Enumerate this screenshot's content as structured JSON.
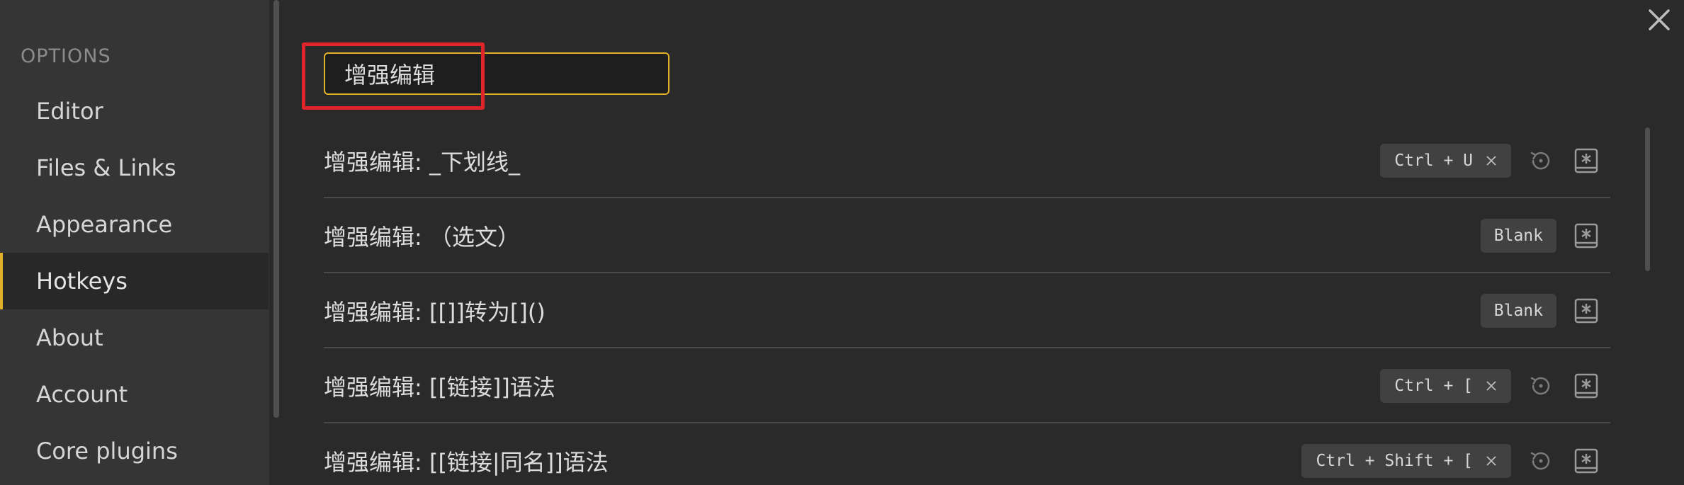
{
  "sidebar": {
    "heading": "OPTIONS",
    "items": [
      {
        "label": "Editor",
        "active": false
      },
      {
        "label": "Files & Links",
        "active": false
      },
      {
        "label": "Appearance",
        "active": false
      },
      {
        "label": "Hotkeys",
        "active": true
      },
      {
        "label": "About",
        "active": false
      },
      {
        "label": "Account",
        "active": false
      },
      {
        "label": "Core plugins",
        "active": false
      }
    ]
  },
  "search": {
    "value": "增强编辑",
    "placeholder": ""
  },
  "hotkeys": [
    {
      "name": "增强编辑: _下划线_",
      "hotkey": "Ctrl + U",
      "removable": true,
      "restore": true
    },
    {
      "name": "增强编辑: （选文）",
      "hotkey": "Blank",
      "removable": false,
      "restore": false
    },
    {
      "name": "增强编辑: [[]]转为[]()",
      "hotkey": "Blank",
      "removable": false,
      "restore": false
    },
    {
      "name": "增强编辑: [[链接]]语法",
      "hotkey": "Ctrl + [",
      "removable": true,
      "restore": true
    },
    {
      "name": "增强编辑: [[链接|同名]]语法",
      "hotkey": "Ctrl + Shift + [",
      "removable": true,
      "restore": true
    }
  ],
  "icons": {
    "close": "close-icon",
    "remove": "x-icon",
    "restore": "reset-icon",
    "add": "add-hotkey-icon"
  },
  "colors": {
    "accent": "#e0b02b",
    "highlight": "#e0242a",
    "background": "#2a2a2a",
    "sidebar": "#353535"
  }
}
